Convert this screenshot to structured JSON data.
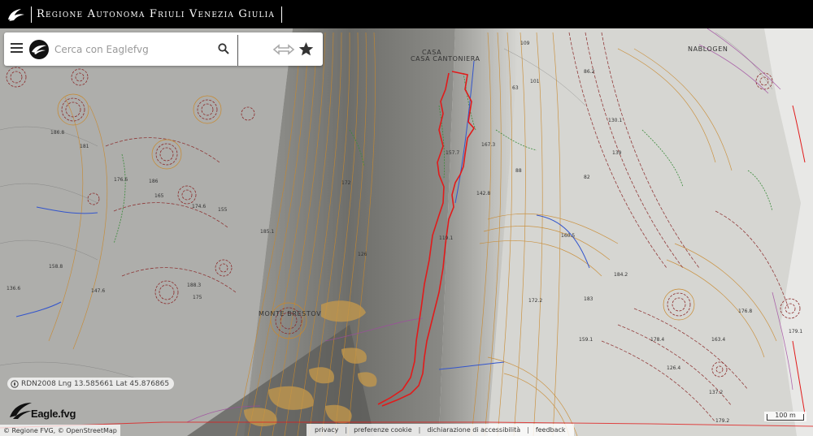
{
  "header": {
    "title": "Regione Autonoma Friuli Venezia Giulia"
  },
  "search": {
    "placeholder": "Cerca con Eaglefvg"
  },
  "icons": {
    "menu": "hamburger-menu-icon",
    "logo": "eagle-icon",
    "search": "search-icon",
    "compare": "swap-arrows-icon",
    "favorite": "star-icon"
  },
  "map": {
    "place_labels": [
      "MONTE BRESTOV",
      "CASA CANTONIERA",
      "NABLOGEN"
    ],
    "spot_heights": [
      "186.8",
      "181",
      "176.6",
      "158.8",
      "136.6",
      "147.6",
      "165",
      "186",
      "174.6",
      "155",
      "185.1",
      "175",
      "188.3",
      "172",
      "126",
      "157.7",
      "167.3",
      "142.8",
      "119.1",
      "88",
      "63",
      "109",
      "101",
      "86.2",
      "130.1",
      "139",
      "82",
      "160.5",
      "184.2",
      "183",
      "178.4",
      "163.4",
      "176.8",
      "172.2",
      "159.1",
      "126.4",
      "137.2",
      "179.1",
      "179.2"
    ],
    "colors": {
      "contour_brown": "#8b2b2b",
      "contour_orange": "#c8882c",
      "contour_gray": "#6f6f6f",
      "boundary_red": "#e11b1b",
      "river_blue": "#3355cc",
      "trail_green": "#3a8a3a",
      "road_purple": "#a04aa0",
      "vegetation_tan": "#c79a4b"
    }
  },
  "coordinates": {
    "text": "RDN2008 Lng 13.585661 Lat 45.876865"
  },
  "brand": {
    "name": "Eagle.fvg"
  },
  "attribution": {
    "text": "© Regione FVG, © OpenStreetMap"
  },
  "footer": {
    "links": [
      "privacy",
      "preferenze cookie",
      "dichiarazione di accessibilità",
      "feedback"
    ]
  },
  "scale": {
    "label": "100 m"
  }
}
